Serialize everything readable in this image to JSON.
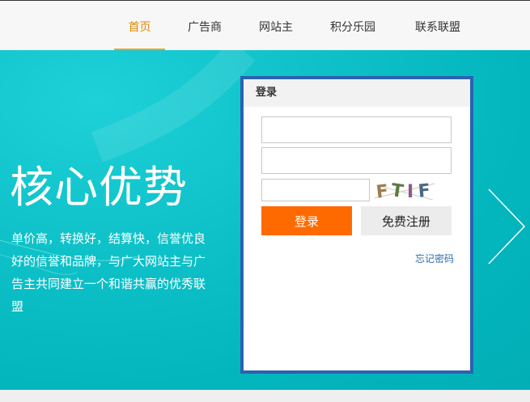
{
  "nav": {
    "items": [
      {
        "label": "首页",
        "active": true
      },
      {
        "label": "广告商"
      },
      {
        "label": "网站主"
      },
      {
        "label": "积分乐园"
      },
      {
        "label": "联系联盟"
      }
    ],
    "active_color": "#f0a020"
  },
  "hero": {
    "title": "核心优势",
    "description": "单价高，转换好，结算快，信誉优良好的信誉和品牌，与广大网站主与广告主共同建立一个和谐共赢的优秀联盟",
    "background_color": "#03b6be",
    "next_icon": "chevron-right-icon"
  },
  "login": {
    "header": "登录",
    "username": {
      "value": "",
      "placeholder": ""
    },
    "password": {
      "value": "",
      "placeholder": ""
    },
    "captcha_input": {
      "value": "",
      "placeholder": ""
    },
    "captcha_text": "FTIF",
    "login_button": "登录",
    "register_button": "免费注册",
    "forgot_link": "忘记密码",
    "border_color": "#2b62b0",
    "login_button_color": "#ff6a00"
  }
}
